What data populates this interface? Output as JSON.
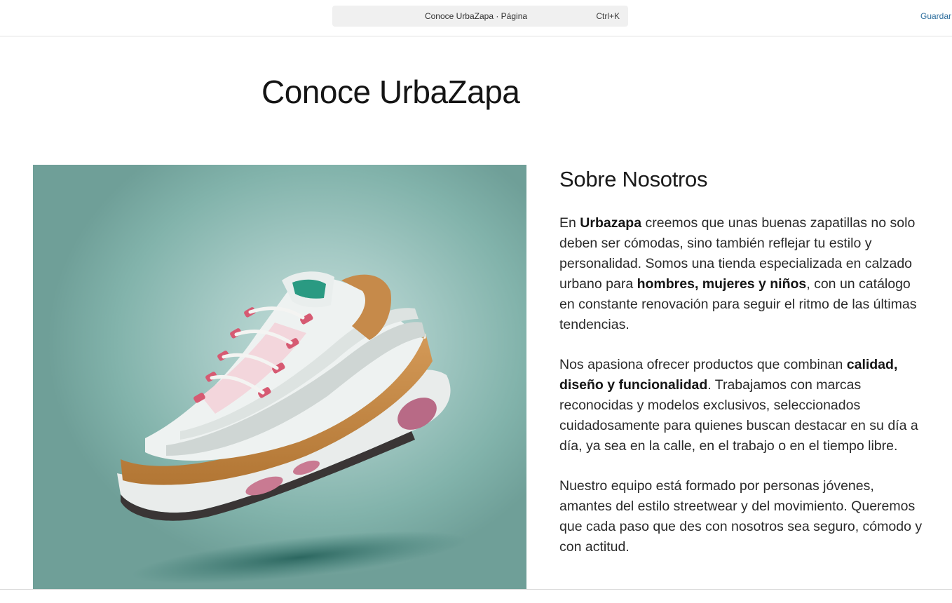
{
  "topbar": {
    "search_title": "Conoce UrbaZapa · Página",
    "search_shortcut": "Ctrl+K",
    "save_label": "Guardar"
  },
  "page": {
    "title": "Conoce UrbaZapa"
  },
  "hero": {
    "image_icon": "sneaker-photo"
  },
  "about": {
    "heading": "Sobre Nosotros",
    "p1": {
      "t1": "En ",
      "b1": "Urbazapa",
      "t2": " creemos que unas buenas zapatillas no solo deben ser cómodas, sino también reflejar tu estilo y personalidad. Somos una tienda especializada en calzado urbano para ",
      "b2": "hombres, mujeres y niños",
      "t3": ", con un catálogo en constante renovación para seguir el ritmo de las últimas tendencias."
    },
    "p2": {
      "t1": "Nos apasiona ofrecer productos que combinan ",
      "b1": "calidad, diseño y funcionalidad",
      "t2": ". Trabajamos con marcas reconocidas y modelos exclusivos, seleccionados cuidadosamente para quienes buscan destacar en su día a día, ya sea en la calle, en el trabajo o en el tiempo libre."
    },
    "p3": "Nuestro equipo está formado por personas jóvenes, amantes del estilo streetwear y del movimiento. Queremos que cada paso que des con nosotros sea seguro, cómodo y con actitud."
  },
  "colors": {
    "link": "#2f6f9e",
    "hero_bg": "#82b3ab"
  }
}
